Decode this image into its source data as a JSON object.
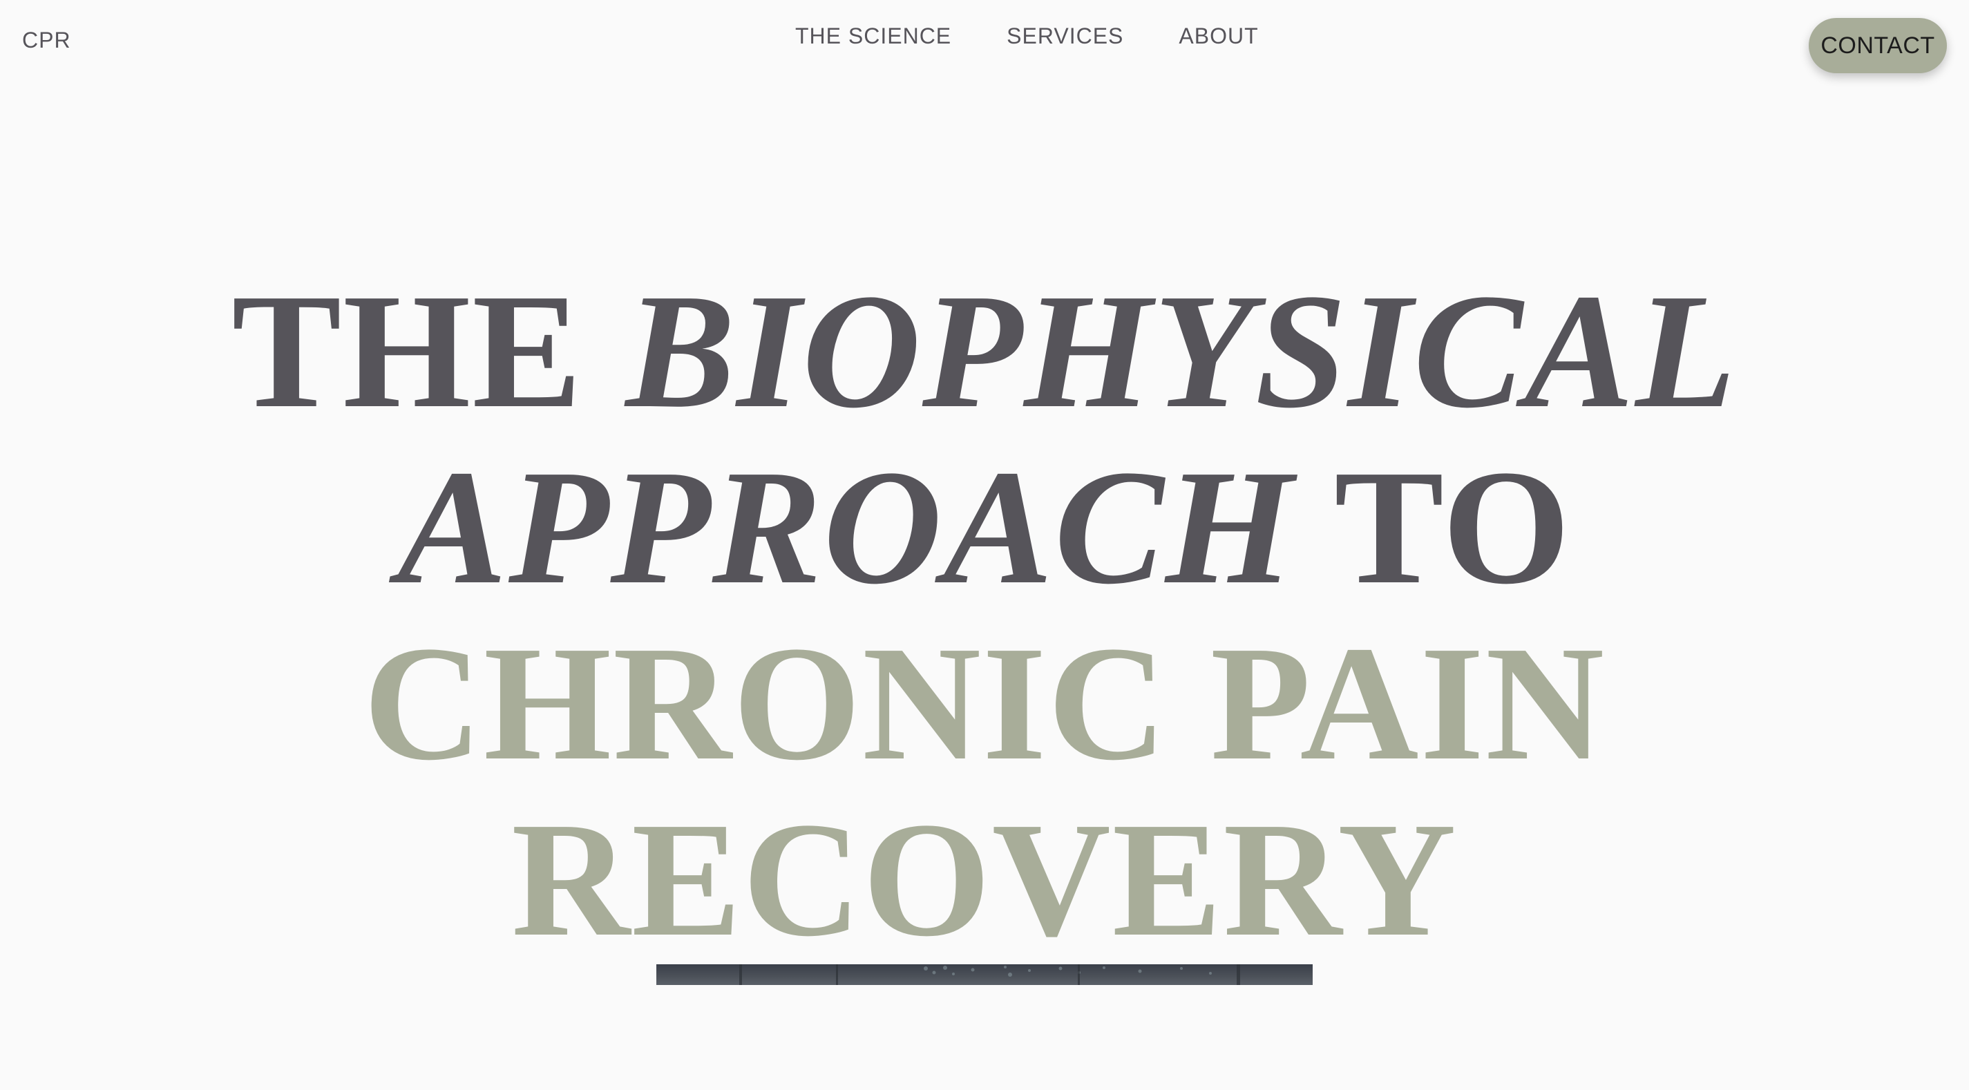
{
  "header": {
    "logo_text": "CPR",
    "nav": [
      {
        "label": "THE SCIENCE"
      },
      {
        "label": "SERVICES"
      },
      {
        "label": "ABOUT"
      }
    ],
    "contact_label": "CONTACT"
  },
  "hero": {
    "line1_plain": "THE ",
    "line1_italic": "BIOPHYSICAL",
    "line2_italic": "APPROACH",
    "line2_plain": " TO",
    "line3": "CHRONIC PAIN",
    "line4": "RECOVERY"
  },
  "colors": {
    "background": "#fafafa",
    "text_dark": "#56545a",
    "accent_sage": "#a8ad99"
  }
}
